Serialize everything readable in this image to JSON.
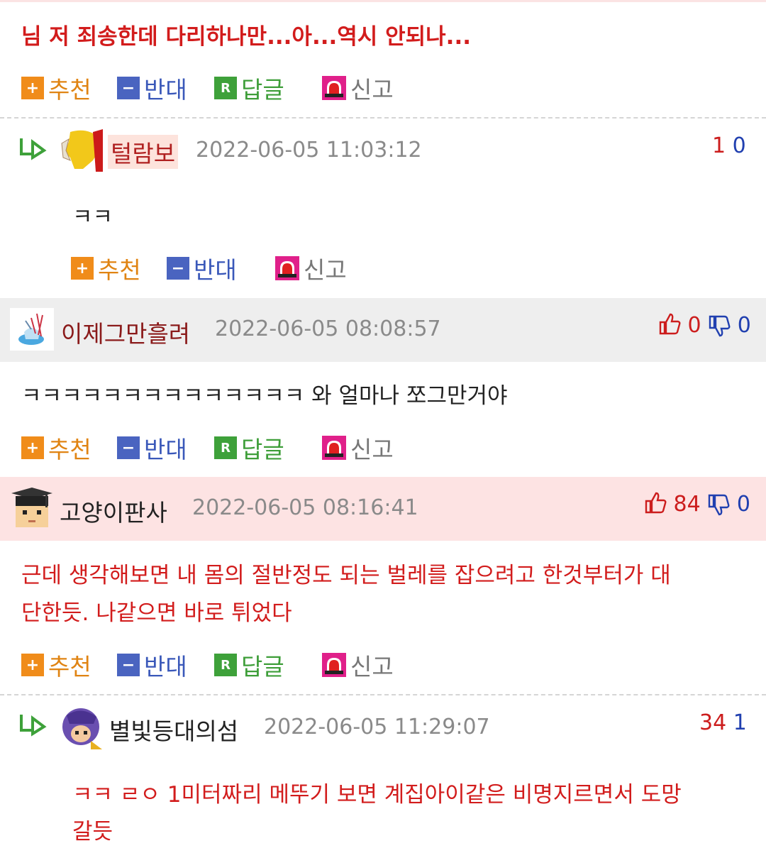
{
  "comments": [
    {
      "body": "님 저 죄송한데 다리하나만...아...역시 안되나...",
      "actions": {
        "recommend": "추천",
        "oppose": "반대",
        "reply": "답글",
        "report": "신고"
      }
    },
    {
      "nickname": "털람보",
      "date": "2022-06-05 11:03:12",
      "vote_up": "1",
      "vote_down": "0",
      "body": "ㅋㅋ",
      "actions": {
        "recommend": "추천",
        "oppose": "반대",
        "report": "신고"
      }
    },
    {
      "nickname": "이제그만흘려",
      "date": "2022-06-05 08:08:57",
      "vote_up": "0",
      "vote_down": "0",
      "body": "ㅋㅋㅋㅋㅋㅋㅋㅋㅋㅋㅋㅋㅋㅋ 와 얼마나 쪼그만거야",
      "actions": {
        "recommend": "추천",
        "oppose": "반대",
        "reply": "답글",
        "report": "신고"
      }
    },
    {
      "nickname": "고양이판사",
      "date": "2022-06-05 08:16:41",
      "vote_up": "84",
      "vote_down": "0",
      "body_line1": "근데 생각해보면 내 몸의 절반정도 되는 벌레를 잡으려고 한것부터가 대",
      "body_line2": "단한듯. 나같으면 바로 튀었다",
      "actions": {
        "recommend": "추천",
        "oppose": "반대",
        "reply": "답글",
        "report": "신고"
      }
    },
    {
      "nickname": "별빛등대의섬",
      "date": "2022-06-05 11:29:07",
      "vote_up": "34",
      "vote_down": "1",
      "body_line1": "ㅋㅋ ㄹㅇ 1미터짜리 메뚜기 보면 계집아이같은 비명지르면서 도망",
      "body_line2": "갈듯"
    }
  ],
  "icons": {
    "recommend": "plus-square-icon",
    "oppose": "minus-square-icon",
    "reply": "reply-r-icon",
    "report": "alarm-siren-icon",
    "reply_arrow": "reply-arrow-icon",
    "thumb_up": "thumbs-up-icon",
    "thumb_down": "thumbs-down-icon"
  },
  "colors": {
    "best_text": "#d21c1c",
    "gray_band": "#eeeeee",
    "pink_band": "#fde3e3",
    "recommend": "#f08c1a",
    "oppose": "#4a64c0",
    "reply": "#3ea13a"
  }
}
